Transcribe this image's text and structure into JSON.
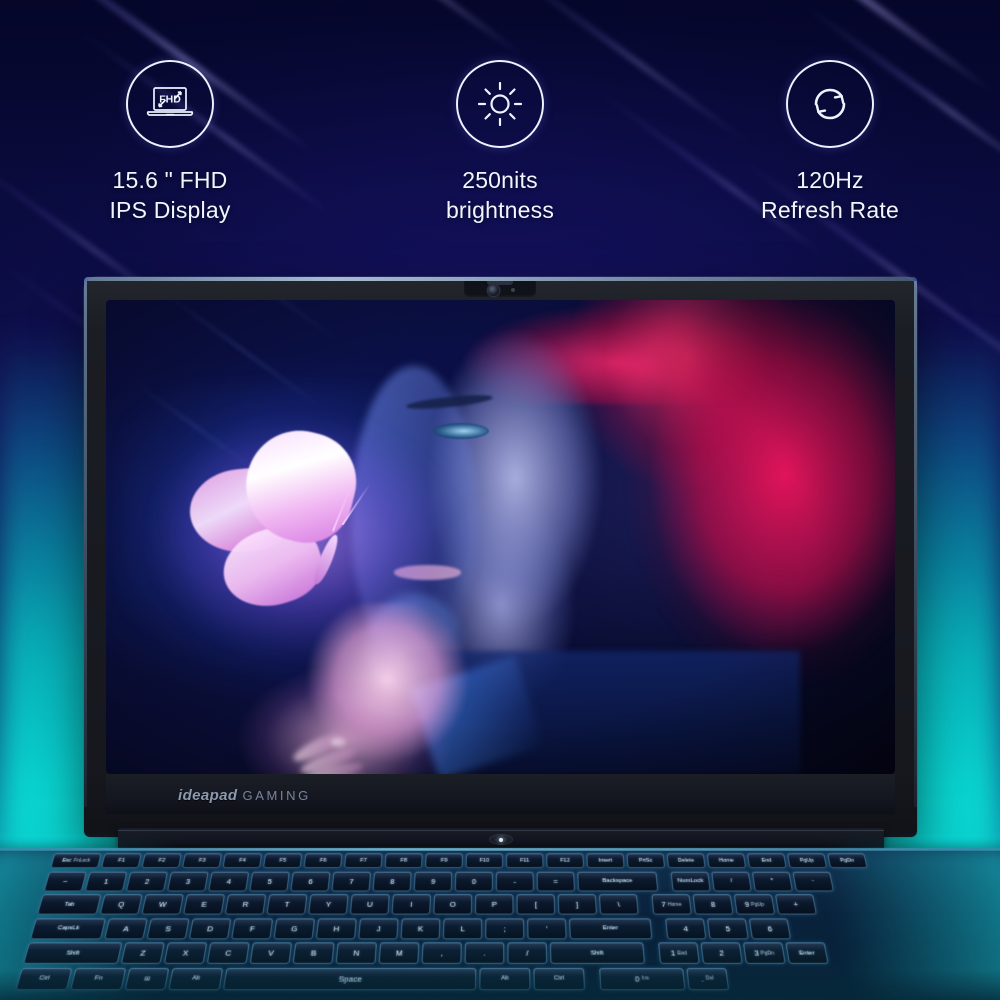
{
  "page": {
    "product_brand_primary": "ideapad",
    "product_brand_secondary": "GAMING"
  },
  "colors": {
    "background_navy": "#0a0b3a",
    "background_cyan": "#08c2c4",
    "icon_stroke": "#eef2ff",
    "text": "#f2f5ff",
    "butterfly_pink": "#e58fe0",
    "hair_red": "#ec145a",
    "key_glow": "#4aa0d7"
  },
  "features": [
    {
      "icon": "laptop-fhd-icon",
      "icon_label": "FHD",
      "line1": "15.6 \" FHD",
      "line2": "IPS Display"
    },
    {
      "icon": "brightness-sun-icon",
      "icon_label": "",
      "line1": "250nits",
      "line2": "brightness"
    },
    {
      "icon": "refresh-rate-icon",
      "icon_label": "",
      "line1": "120Hz",
      "line2": "Refresh Rate"
    }
  ],
  "keyboard": {
    "function_row": [
      {
        "label": "Esc",
        "sub": "FnLock",
        "w": "u125"
      },
      {
        "label": "F1",
        "sub": "",
        "w": "u1"
      },
      {
        "label": "F2",
        "sub": "",
        "w": "u1"
      },
      {
        "label": "F3",
        "sub": "",
        "w": "u1"
      },
      {
        "label": "F4",
        "sub": "",
        "w": "u1"
      },
      {
        "label": "F5",
        "sub": "",
        "w": "u1"
      },
      {
        "label": "F6",
        "sub": "",
        "w": "u1"
      },
      {
        "label": "F7",
        "sub": "",
        "w": "u1"
      },
      {
        "label": "F8",
        "sub": "",
        "w": "u1"
      },
      {
        "label": "F9",
        "sub": "",
        "w": "u1"
      },
      {
        "label": "F10",
        "sub": "",
        "w": "u1"
      },
      {
        "label": "F11",
        "sub": "",
        "w": "u1"
      },
      {
        "label": "F12",
        "sub": "",
        "w": "u1"
      },
      {
        "label": "Insert",
        "sub": "",
        "w": "u1"
      },
      {
        "label": "PrtSc",
        "sub": "",
        "w": "u1"
      },
      {
        "label": "Delete",
        "sub": "",
        "w": "u1"
      },
      {
        "label": "Home",
        "sub": "",
        "w": "u1"
      },
      {
        "label": "End",
        "sub": "",
        "w": "u1"
      },
      {
        "label": "PgUp",
        "sub": "",
        "w": "u1"
      },
      {
        "label": "PgDn",
        "sub": "",
        "w": "u1"
      }
    ],
    "number_row": [
      "~",
      "1",
      "2",
      "3",
      "4",
      "5",
      "6",
      "7",
      "8",
      "9",
      "0",
      "-",
      "=",
      "Backspace"
    ],
    "top_row": [
      "Tab",
      "Q",
      "W",
      "E",
      "R",
      "T",
      "Y",
      "U",
      "I",
      "O",
      "P",
      "[",
      "]",
      "\\"
    ],
    "home_row": [
      "CapsLk",
      "A",
      "S",
      "D",
      "F",
      "G",
      "H",
      "J",
      "K",
      "L",
      ";",
      "'",
      "Enter"
    ],
    "shift_row": [
      "Shift",
      "Z",
      "X",
      "C",
      "V",
      "B",
      "N",
      "M",
      ",",
      ".",
      "/",
      "Shift"
    ],
    "bottom_row": [
      "Ctrl",
      "Fn",
      "Win",
      "Alt",
      "Space",
      "Alt",
      "Ctrl"
    ],
    "numpad_rows": [
      [
        "NumLock",
        "/",
        "*",
        "-"
      ],
      [
        "7",
        "8",
        "9",
        "+"
      ],
      [
        "4",
        "5",
        "6",
        ""
      ],
      [
        "1",
        "2",
        "3",
        "Enter"
      ],
      [
        "0",
        ".",
        "",
        ""
      ]
    ],
    "numpad_subs": {
      "7": "Home",
      "8": "",
      "9": "PgUp",
      "4": "",
      "5": "",
      "6": "",
      "1": "End",
      "2": "",
      "3": "PgDn",
      "0": "Ins",
      ".": "Del"
    }
  },
  "display": {
    "wallpaper_description": "woman profile with red hair and glowing pink butterfly on hand",
    "webcam": "webcam-module"
  }
}
